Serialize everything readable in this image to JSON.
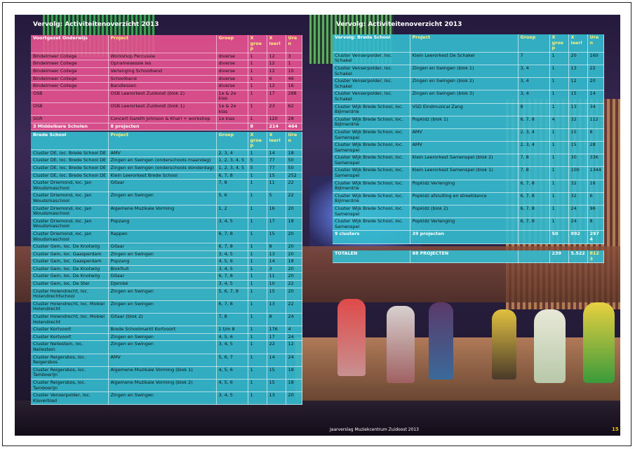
{
  "header": {
    "left_title": "Vervolg: Activiteitenoverzicht 2013",
    "right_title": "Vervolg: Activiteitenoverzicht 2013"
  },
  "columns": {
    "project": "Project",
    "groep": "Groep",
    "x_groep": "X groep",
    "x_leerl": "X leerl",
    "uren": "Uren"
  },
  "vo_table": {
    "heading": "Voortgezet Onderwijs",
    "rows": [
      [
        "Bindelmeer College",
        "Workshop Percussie",
        "diverse",
        "1",
        "12",
        "3"
      ],
      [
        "Bindelmeer College",
        "Opnamesessie les",
        "diverse",
        "1",
        "12",
        "1"
      ],
      [
        "Bindelmeer College",
        "Verlenging Schoolband",
        "diverse",
        "1",
        "12",
        "10"
      ],
      [
        "Bindelmeer College",
        "Schoolband",
        "diverse",
        "1",
        "6",
        "46"
      ],
      [
        "Bindelmeer College",
        "Bandlessen",
        "diverse",
        "1",
        "12",
        "16"
      ],
      [
        "OSB",
        "OSB Leerorkest Zuidoost (blok 2)",
        "1e & 2e klas",
        "1",
        "17",
        "288"
      ],
      [
        "OSB",
        "OSB Leerorkest Zuidoost (blok 1)",
        "1e & 2e klas",
        "1",
        "23",
        "62"
      ],
      [
        "SGR",
        "Concert Gareth Johnson & Khari + workshop",
        "1e klas",
        "1",
        "120",
        "28"
      ]
    ],
    "total": [
      "3 Middelbare Scholen",
      "8 projecten",
      "",
      "8",
      "214",
      "464"
    ]
  },
  "bs_table": {
    "heading": "Brede School",
    "rows": [
      [
        "Cluster DE, loc. Brede School DE",
        "AMV",
        "2, 3, 4",
        "1",
        "14",
        "18"
      ],
      [
        "Cluster DE, loc. Brede School DE",
        "Zingen en Swingen (onderschools maandag)",
        "1, 2, 3, 4, 5",
        "5",
        "77",
        "50"
      ],
      [
        "Cluster DE, loc. Brede School DE",
        "Zingen en Swingen (onderschools donderdag)",
        "1, 2, 3, 4, 5",
        "5",
        "77",
        "50"
      ],
      [
        "Cluster DE, loc. Brede School DE",
        "Klein Leerorkest Brede School",
        "6, 7, 8",
        "1",
        "15",
        "252"
      ],
      [
        "Cluster Driemond, loc. Jan Woudsmaschool",
        "Gitaar",
        "7, 8",
        "1",
        "11",
        "22"
      ],
      [
        "Cluster Driemond, loc. Jan Woudsmaschool",
        "Zingen en Swingen",
        "5, 6",
        "1",
        "5",
        "22"
      ],
      [
        "Cluster Driemond, loc. Jan Woudsmaschool",
        "Algemene Muzikale Vorming",
        "1, 2",
        "1",
        "16",
        "20"
      ],
      [
        "Cluster Driemond, loc. Jan Woudsmaschool",
        "Popzang",
        "3, 4, 5",
        "1",
        "17",
        "18"
      ],
      [
        "Cluster Driemond, loc. Jan Woudsmaschool",
        "Rappen",
        "6, 7, 8",
        "1",
        "15",
        "20"
      ],
      [
        "Cluster Gein, loc. De Knotwilg",
        "Gitaar",
        "6, 7, 8",
        "1",
        "8",
        "20"
      ],
      [
        "Cluster Gein, loc. Gaasperdam",
        "Zingen en Swingen",
        "3, 4, 5",
        "1",
        "13",
        "20"
      ],
      [
        "Cluster Gein, loc. Gaasperdam",
        "Popzang",
        "4, 5, 6",
        "1",
        "14",
        "18"
      ],
      [
        "Cluster Gein, loc. De Knotwilg",
        "Blokfluit",
        "3, 4, 5",
        "1",
        "3",
        "20"
      ],
      [
        "Cluster Gein, loc. De Knotwilg",
        "Gitaar",
        "6, 7, 8",
        "1",
        "11",
        "20"
      ],
      [
        "Cluster Gein, loc. De Ster",
        "Djembé",
        "3, 4, 5",
        "1",
        "10",
        "22"
      ],
      [
        "Cluster Holendrecht, loc. Holendrechtschool",
        "Zingen en Swingen",
        "5, 6, 7, 8",
        "1",
        "15",
        "20"
      ],
      [
        "Cluster Holendrecht, loc. Mobiel Holendrecht",
        "Zingen en Swingen",
        "6, 7, 8",
        "1",
        "13",
        "22"
      ],
      [
        "Cluster Holendrecht, loc. Mobiel Holendrecht",
        "Gitaar (blok 2)",
        "7, 8",
        "1",
        "8",
        "24"
      ],
      [
        "Cluster Kortvoort",
        "Brede Schoolmarkt Kortvoort",
        "1 t/m 8",
        "1",
        "176",
        "4"
      ],
      [
        "Cluster Kortvoort",
        "Zingen en Swingen",
        "4, 5, 6",
        "1",
        "17",
        "24"
      ],
      [
        "Cluster Nellestein, loc. Nellestein",
        "Zingen en Swingen",
        "3, 4, 5",
        "1",
        "22",
        "12"
      ],
      [
        "Cluster Reigersbos, loc. Reigersbos",
        "AMV",
        "5, 6, 7",
        "1",
        "14",
        "24"
      ],
      [
        "Cluster Reigersbos, loc. Tamboerijn",
        "Algemene Muzikale Vorming (blok 1)",
        "4, 5, 6",
        "1",
        "15",
        "18"
      ],
      [
        "Cluster Reigersbos, loc. Tamboerijn",
        "Algemene Muzikale Vorming (blok 2)",
        "4, 5, 6",
        "1",
        "15",
        "18"
      ],
      [
        "Cluster Venserpolder, loc. Klaverblad",
        "Zingen en Swingen",
        "3, 4, 5",
        "1",
        "13",
        "20"
      ]
    ]
  },
  "right_table": {
    "heading": "Vervolg: Brede School",
    "rows": [
      [
        "Cluster Venserpolder, loc. Schakel",
        "Klein Leerorkest De Schakel",
        "7",
        "1",
        "20",
        "160"
      ],
      [
        "Cluster Venserpolder, loc. Schakel",
        "Zingen en Swingen (blok 1)",
        "3, 4",
        "1",
        "13",
        "22"
      ],
      [
        "Cluster Venserpolder, loc. Schakel",
        "Zingen en Swingen (blok 2)",
        "3, 4",
        "1",
        "12",
        "20"
      ],
      [
        "Cluster Venserpolder, loc. Schakel",
        "Zingen en Swingen (blok 3)",
        "3, 4",
        "1",
        "15",
        "14"
      ],
      [
        "Cluster Wijk Brede School, loc. Bijlmerdrie",
        "VSD Eindmusical Zang",
        "8",
        "1",
        "13",
        "34"
      ],
      [
        "Cluster Wijk Brede School, loc. Bijlmerdrie",
        "Popkidz (blok 1)",
        "6, 7, 8",
        "4",
        "32",
        "112"
      ],
      [
        "Cluster Wijk Brede School, loc. Samenspel",
        "AMV",
        "2, 3, 4",
        "1",
        "15",
        "8"
      ],
      [
        "Cluster Wijk Brede School, loc. Samenspel",
        "AMV",
        "2, 3, 4",
        "1",
        "15",
        "28"
      ],
      [
        "Cluster Wijk Brede School, loc. Samenspel",
        "Klein Leerorkest Samenspel (blok 2)",
        "7, 8",
        "1",
        "30",
        "336"
      ],
      [
        "Cluster Wijk Brede School, loc. Samenspel",
        "Klein Leerorkest Samenspel (blok 1)",
        "7, 8",
        "1",
        "100",
        "1344"
      ],
      [
        "Cluster Wijk Brede School, loc. Bijlmerdrie",
        "Popkidz Verlenging",
        "6, 7, 8",
        "1",
        "32",
        "16"
      ],
      [
        "Cluster Wijk Brede School, loc. Bijlmerdrie",
        "Popkidz afsluiting en streetdance",
        "6, 7, 8",
        "1",
        "32",
        "6"
      ],
      [
        "Cluster Wijk Brede School, loc. Samenspel",
        "Popkidz (blok 2)",
        "6, 7, 8",
        "1",
        "24",
        "96"
      ],
      [
        "Cluster Wijk Brede School, loc. Samenspel",
        "Popkidz Verlenging",
        "6, 7, 8",
        "1",
        "24",
        "8"
      ]
    ],
    "total": [
      "9 clusters",
      "39 projecten",
      "",
      "50",
      "992",
      "2974"
    ]
  },
  "totals_table": {
    "row": [
      "TOTALEN",
      "88 PROJECTEN",
      "",
      "239",
      "5.522",
      "8123"
    ]
  },
  "footer": {
    "text": "Jaarverslag Muziekcentrum Zuidoost 2013",
    "page_number": "15"
  },
  "colors": {
    "pink_panel": "#e85291",
    "teal_panel": "#34bacd",
    "header_highlight": "#fff07a",
    "page_number": "#f0c800"
  }
}
